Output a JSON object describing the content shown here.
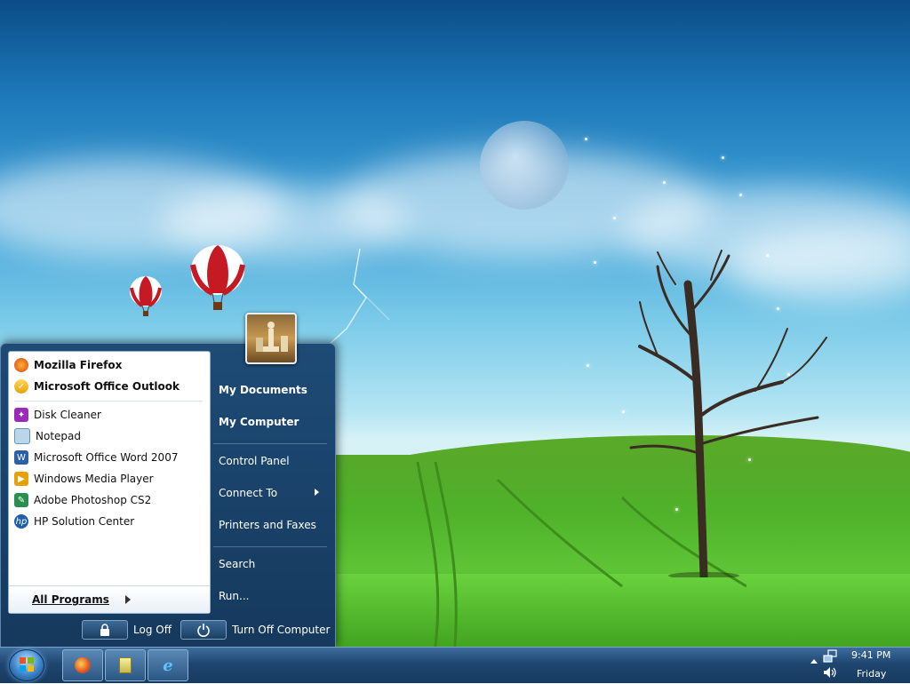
{
  "start_menu": {
    "pinned": [
      {
        "label": "Mozilla Firefox",
        "icon": "firefox-icon"
      },
      {
        "label": "Microsoft Office Outlook",
        "icon": "outlook-icon"
      }
    ],
    "recent": [
      {
        "label": "Disk Cleaner",
        "icon": "disk-cleaner-icon"
      },
      {
        "label": "Notepad",
        "icon": "notepad-icon"
      },
      {
        "label": "Microsoft Office Word 2007",
        "icon": "word-icon"
      },
      {
        "label": "Windows Media Player",
        "icon": "media-player-icon"
      },
      {
        "label": "Adobe Photoshop CS2",
        "icon": "photoshop-icon"
      },
      {
        "label": "HP Solution Center",
        "icon": "hp-icon"
      }
    ],
    "all_programs": "All Programs",
    "right": {
      "my_documents": "My Documents",
      "my_computer": "My Computer",
      "control_panel": "Control Panel",
      "connect_to": "Connect To",
      "printers": "Printers and Faxes",
      "search": "Search",
      "run": "Run..."
    },
    "log_off": "Log Off",
    "turn_off": "Turn Off Computer"
  },
  "taskbar": {
    "time": "9:41 PM",
    "day": "Friday",
    "buttons": [
      "firefox-icon",
      "folder-icon",
      "internet-explorer-icon"
    ]
  },
  "colors": {
    "menu_bg": "#1d4b76",
    "taskbar_bg": "#1f4670",
    "accent": "#3b83c8"
  }
}
